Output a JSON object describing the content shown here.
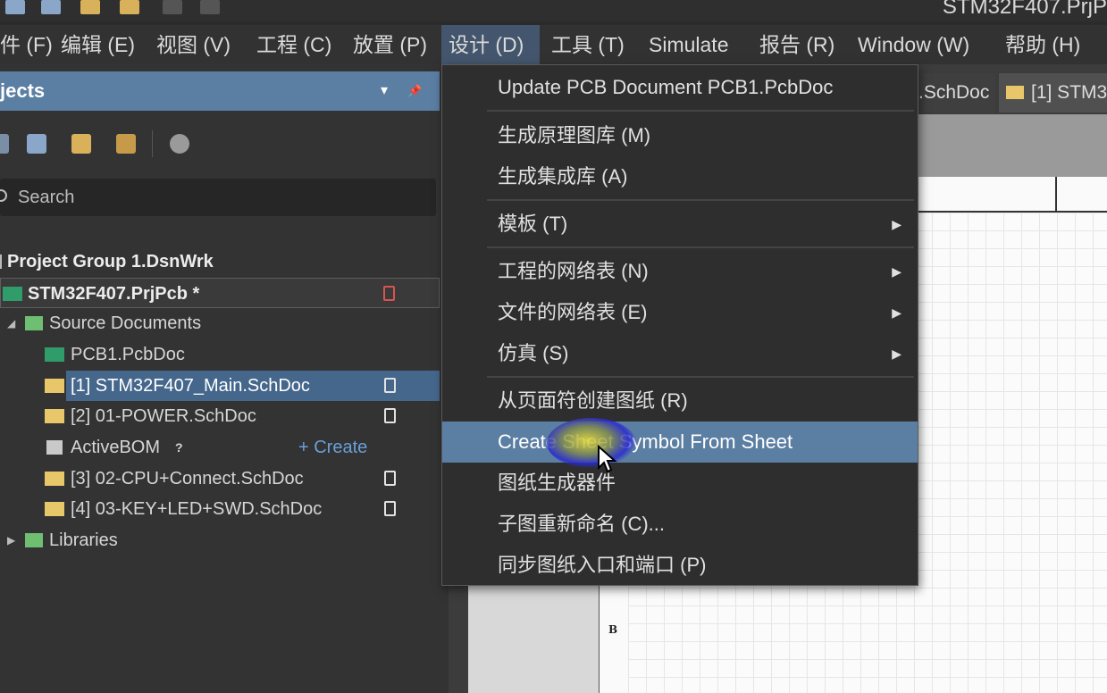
{
  "window": {
    "title": "STM32F407.PrjP"
  },
  "menubar": {
    "items": [
      "件 (F)",
      "编辑 (E)",
      "视图 (V)",
      "工程 (C)",
      "放置 (P)",
      "设计 (D)",
      "工具 (T)",
      "Simulate",
      "报告 (R)",
      "Window (W)",
      "帮助 (H)"
    ],
    "active_index": 5
  },
  "projects_panel": {
    "title": "jects",
    "menu_glyph": "▾",
    "pin_glyph": "📌",
    "search_placeholder": "Search",
    "tree": {
      "group": "Project Group 1.DsnWrk",
      "project": "STM32F407.PrjPcb *",
      "source_folder": "Source Documents",
      "docs": [
        "PCB1.PcbDoc",
        "[1] STM32F407_Main.SchDoc",
        "[2] 01-POWER.SchDoc",
        "ActiveBOM",
        "[3] 02-CPU+Connect.SchDoc",
        "[4] 03-KEY+LED+SWD.SchDoc"
      ],
      "activebom_help": "?",
      "activebom_create": "+ Create",
      "libraries_folder": "Libraries"
    }
  },
  "document_tabs": [
    ".SchDoc",
    "[1] STM3"
  ],
  "schematic": {
    "zone_label": "B"
  },
  "design_menu": {
    "items": [
      {
        "label": "Update PCB Document PCB1.PcbDoc",
        "submenu": false
      },
      {
        "label": "生成原理图库 (M)",
        "submenu": false
      },
      {
        "label": "生成集成库 (A)",
        "submenu": false
      },
      {
        "label": "模板 (T)",
        "submenu": true
      },
      {
        "label": "工程的网络表 (N)",
        "submenu": true
      },
      {
        "label": "文件的网络表 (E)",
        "submenu": true
      },
      {
        "label": "仿真 (S)",
        "submenu": true
      },
      {
        "label": "从页面符创建图纸 (R)",
        "submenu": false
      },
      {
        "label": "Create Sheet Symbol From Sheet",
        "submenu": false,
        "highlighted": true
      },
      {
        "label": "图纸生成器件",
        "submenu": false
      },
      {
        "label": "子图重新命名 (C)...",
        "submenu": false
      },
      {
        "label": "同步图纸入口和端口 (P)",
        "submenu": false
      }
    ],
    "submenu_glyph": "▶"
  },
  "colors": {
    "accent": "#5b7ea3",
    "menu_active": "#44566d",
    "background": "#2b2b2b",
    "highlight_cursor": "#2828d0"
  }
}
